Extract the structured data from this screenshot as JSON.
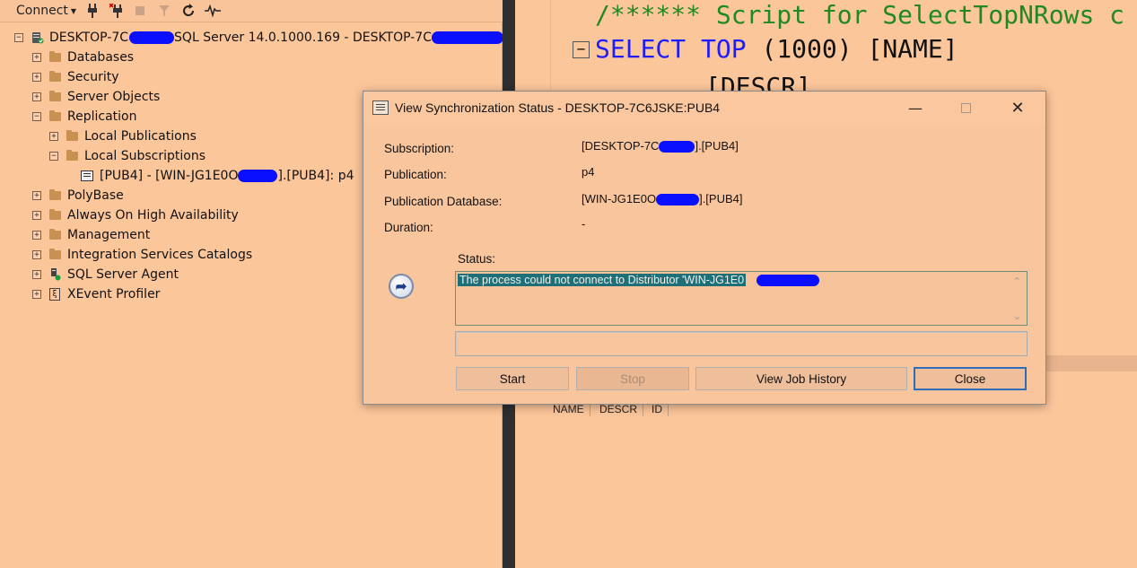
{
  "object_explorer": {
    "toolbar": {
      "connect_label": "Connect"
    },
    "tree": {
      "server": {
        "label_prefix": "DESKTOP-7C",
        "label_mid": "SQL Server 14.0.1000.169 - DESKTOP-7C"
      },
      "items": [
        {
          "label": "Databases",
          "expander": "+"
        },
        {
          "label": "Security",
          "expander": "+"
        },
        {
          "label": "Server Objects",
          "expander": "+"
        },
        {
          "label": "Replication",
          "expander": "−"
        },
        {
          "label": "Local Publications",
          "expander": "+"
        },
        {
          "label": "Local Subscriptions",
          "expander": "−"
        },
        {
          "label_prefix": "[PUB4] - [WIN-JG1E0O",
          "label_suffix": "].[PUB4]: p4"
        },
        {
          "label": "PolyBase",
          "expander": "+"
        },
        {
          "label": "Always On High Availability",
          "expander": "+"
        },
        {
          "label": "Management",
          "expander": "+"
        },
        {
          "label": "Integration Services Catalogs",
          "expander": "+"
        },
        {
          "label": "SQL Server Agent",
          "expander": "+"
        },
        {
          "label": "XEvent Profiler",
          "expander": "+"
        }
      ]
    }
  },
  "editor": {
    "comment": "/****** Script for SelectTopNRows c",
    "select_kw": "SELECT",
    "top_kw": "TOP",
    "paren_open": "(",
    "top_n": "1000",
    "paren_close": ")",
    "col1": "[NAME]",
    "col2": "[DESCR]",
    "collapse": "−",
    "result_headers": [
      "NAME",
      "DESCR",
      "ID"
    ]
  },
  "dialog": {
    "title": "View Synchronization Status - DESKTOP-7C6JSKE:PUB4",
    "fields": {
      "subscription_label": "Subscription:",
      "subscription_value_prefix": "[DESKTOP-7C",
      "subscription_value_suffix": "].[PUB4]",
      "publication_label": "Publication:",
      "publication_value": "p4",
      "pubdb_label": "Publication Database:",
      "pubdb_value_prefix": "[WIN-JG1E0O",
      "pubdb_value_suffix": "].[PUB4]",
      "duration_label": "Duration:",
      "duration_value": "-"
    },
    "status_label": "Status:",
    "status_text": "The process could not connect to Distributor 'WIN-JG1E0",
    "buttons": {
      "start": "Start",
      "stop": "Stop",
      "view_job_history": "View Job History",
      "close": "Close"
    },
    "window_controls": {
      "minimize": "—",
      "close": "✕"
    }
  }
}
